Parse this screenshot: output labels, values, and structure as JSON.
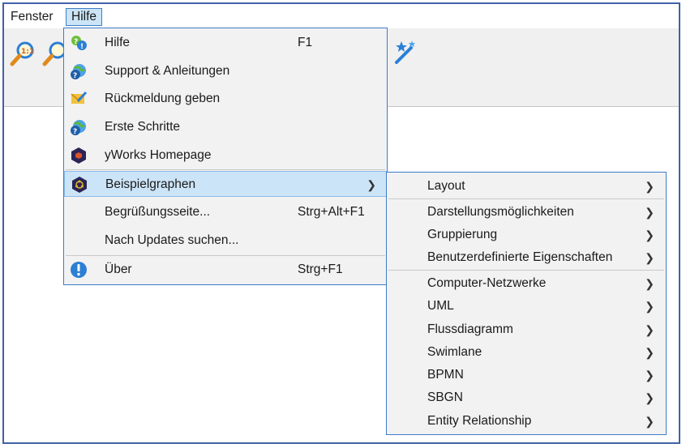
{
  "menubar": {
    "items": [
      {
        "label": "Fenster"
      },
      {
        "label": "Hilfe"
      }
    ]
  },
  "toolbar": {
    "icons": [
      "zoom-original-icon",
      "zoom-icon",
      "magic-wand-icon"
    ]
  },
  "help_menu": {
    "items": [
      {
        "label": "Hilfe",
        "shortcut": "F1",
        "icon": "help-icon"
      },
      {
        "label": "Support & Anleitungen",
        "shortcut": "",
        "icon": "globe-help-icon"
      },
      {
        "label": "Rückmeldung geben",
        "shortcut": "",
        "icon": "feedback-icon"
      },
      {
        "label": "Erste Schritte",
        "shortcut": "",
        "icon": "globe-help-icon"
      },
      {
        "label": "yWorks Homepage",
        "shortcut": "",
        "icon": "yworks-logo-icon"
      },
      {
        "label": "Beispielgraphen",
        "shortcut": "",
        "icon": "yworks-graph-icon",
        "submenu": true,
        "highlighted": true
      },
      {
        "label": "Begrüßungsseite...",
        "shortcut": "Strg+Alt+F1"
      },
      {
        "label": "Nach Updates suchen..."
      },
      {
        "label": "Über",
        "shortcut": "Strg+F1",
        "icon": "info-icon"
      }
    ]
  },
  "sub_menu": {
    "items": [
      {
        "label": "Layout"
      },
      {
        "label": "Darstellungsmöglichkeiten"
      },
      {
        "label": "Gruppierung"
      },
      {
        "label": "Benutzerdefinierte Eigenschaften"
      },
      {
        "label": "Computer-Netzwerke"
      },
      {
        "label": "UML"
      },
      {
        "label": "Flussdiagramm"
      },
      {
        "label": "Swimlane"
      },
      {
        "label": "BPMN"
      },
      {
        "label": "SBGN"
      },
      {
        "label": "Entity Relationship"
      }
    ]
  },
  "colors": {
    "accent": "#3d7cc9",
    "highlight": "#cce4f7",
    "menu_bg": "#f2f2f2"
  }
}
